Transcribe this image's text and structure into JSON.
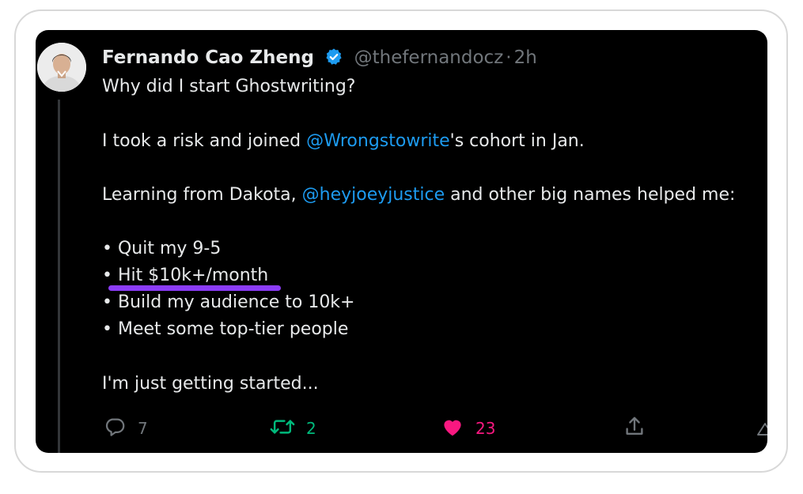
{
  "tweet": {
    "author_name": "Fernando Cao Zheng",
    "handle": "@thefernandocz",
    "separator": "·",
    "time": "2h",
    "lines": {
      "line1": "Why did I start Ghostwriting?",
      "line2_pre": "I took a risk and joined ",
      "line2_mention": "@Wrongstowrite",
      "line2_post": "'s cohort in Jan.",
      "line3_pre": "Learning from Dakota, ",
      "line3_mention": "@heyjoeyjustice",
      "line3_post": " and other big names helped me:",
      "bullet1": "• Quit my 9-5",
      "bullet2": "• Hit $10k+/month",
      "bullet3": "• Build my audience to 10k+",
      "bullet4": "• Meet some top-tier people",
      "closing": "I'm just getting started..."
    },
    "actions": {
      "replies": "7",
      "retweets": "2",
      "likes": "23"
    }
  },
  "icons": {
    "verified": "verified-badge-icon",
    "reply": "reply-icon",
    "retweet": "retweet-icon",
    "like": "heart-icon",
    "share": "share-icon"
  },
  "colors": {
    "background": "#000000",
    "text": "#e7e9ea",
    "muted": "#71767b",
    "mention": "#1d9bf0",
    "retweet": "#00ba7c",
    "like": "#f91880",
    "highlight_underline": "#8b3cf6"
  }
}
